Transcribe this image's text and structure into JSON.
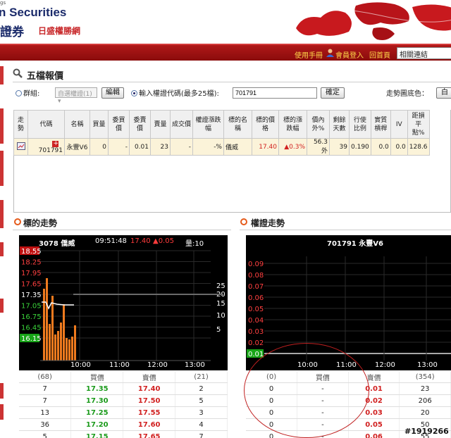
{
  "header": {
    "logo_top": "gs",
    "logo_en": "n Securities",
    "logo_cn": "證券",
    "logo_cn2": "日盛權勝網"
  },
  "nav": {
    "links": [
      "使用手冊",
      "會員登入",
      "回首頁"
    ],
    "select": "相關連結"
  },
  "quote": {
    "title": "五檔報價",
    "group_label": "群組:",
    "group_select": "自選權證(1)",
    "edit_button": "編輯",
    "input_label": "輸入權證代碼(最多25檔):",
    "input_value": "701791",
    "confirm_button": "確定",
    "trend_color_label": "走勢圖底色：",
    "trend_color_value": "白",
    "headers": [
      "走勢",
      "代碼",
      "名稱",
      "買量",
      "委買價",
      "委賣價",
      "賣量",
      "成交價",
      "權證漲跌幅",
      "標的名稱",
      "標的價格",
      "標的漲跌幅",
      "價內外%",
      "剩餘天數",
      "行使比例",
      "實質槓桿",
      "IV",
      "距損平點%"
    ],
    "row": [
      "",
      "701791",
      "永豐V6",
      "0",
      "-",
      "0.01",
      "23",
      "-",
      "-%",
      "儀威",
      "17.40",
      "▲0.3%",
      "56.3 外",
      "39",
      "0.190",
      "0.0",
      "0.0",
      "128.6"
    ]
  },
  "left_chart": {
    "section_title": "標的走勢",
    "head_name": "3078 僑威",
    "head_time": "09:51:48",
    "head_price": "17.40",
    "head_change": "▲0.05",
    "head_vol": "量:10",
    "y_labels": [
      "18.55",
      "18.25",
      "17.95",
      "17.65",
      "17.35",
      "17.05",
      "16.75",
      "16.45",
      "16.15"
    ],
    "vol_labels": [
      "25",
      "20",
      "15",
      "10",
      "5"
    ],
    "x_labels": [
      "10:00",
      "11:00",
      "12:00",
      "13:00"
    ],
    "book_headers": [
      "(68)",
      "買價",
      "賣價",
      "(21)"
    ],
    "book": [
      [
        "7",
        "17.35",
        "17.40",
        "2"
      ],
      [
        "7",
        "17.30",
        "17.50",
        "5"
      ],
      [
        "13",
        "17.25",
        "17.55",
        "3"
      ],
      [
        "36",
        "17.20",
        "17.60",
        "4"
      ],
      [
        "5",
        "17.15",
        "17.65",
        "7"
      ]
    ]
  },
  "right_chart": {
    "section_title": "權證走勢",
    "head": "701791 永豐V6",
    "y_labels": [
      "0.09",
      "0.08",
      "0.07",
      "0.06",
      "0.05",
      "0.04",
      "0.03",
      "0.02",
      "0.01"
    ],
    "x_labels": [
      "10:00",
      "11:00",
      "12:00",
      "13:00"
    ],
    "book_headers": [
      "(0)",
      "買價",
      "賣價",
      "(354)"
    ],
    "book": [
      [
        "0",
        "-",
        "0.01",
        "23"
      ],
      [
        "0",
        "-",
        "0.02",
        "206"
      ],
      [
        "0",
        "-",
        "0.03",
        "20"
      ],
      [
        "0",
        "-",
        "0.05",
        "50"
      ],
      [
        "0",
        "-",
        "0.06",
        "55"
      ]
    ]
  },
  "chart_data": {
    "type": "line",
    "title": "3078 僑威",
    "xlabel": "",
    "ylabel": "",
    "x_ticks": [
      "10:00",
      "11:00",
      "12:00",
      "13:00"
    ],
    "ylim": [
      16.15,
      18.55
    ],
    "series": [],
    "last_price": 17.4,
    "prev_close": 17.35
  },
  "watermark": "#1919266",
  "colors": {
    "nav": "#a01515",
    "accent": "#e55a1a",
    "chart_bg": "#000000",
    "price_red": "#d12020",
    "price_green": "#1a9a1a"
  }
}
